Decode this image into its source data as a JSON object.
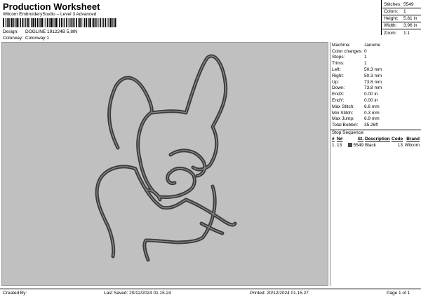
{
  "header": {
    "title": "Production Worksheet",
    "subtitle": "Wilcom EmbroideryStudio – Level 3 Advanced",
    "design_label": "Design:",
    "design_value": "DOGLINE 191224B 5,8IN",
    "colorway_label": "Colorway:",
    "colorway_value": "Colonway 1"
  },
  "stats": [
    {
      "label": "Stitches:",
      "value": "5549"
    },
    {
      "label": "Colors:",
      "value": "1"
    },
    {
      "label": "Height:",
      "value": "5.81 in"
    },
    {
      "label": "Width:",
      "value": "3.96 in"
    },
    {
      "label": "Zoom:",
      "value": "1:1"
    }
  ],
  "machine": [
    {
      "label": "Machine:",
      "value": "Janome"
    },
    {
      "label": "Color changes:",
      "value": "0"
    },
    {
      "label": "Stops:",
      "value": "1"
    },
    {
      "label": "Trims:",
      "value": "1"
    },
    {
      "label": "Left:",
      "value": "50.3 mm"
    },
    {
      "label": "Right:",
      "value": "50.3 mm"
    },
    {
      "label": "Up:",
      "value": "73.8 mm"
    },
    {
      "label": "Down:",
      "value": "73.8 mm"
    },
    {
      "label": "EndX:",
      "value": "0.00 in"
    },
    {
      "label": "EndY:",
      "value": "0.00 in"
    },
    {
      "label": "Max Stitch:",
      "value": "6.6 mm"
    },
    {
      "label": "Min Stitch:",
      "value": "0.3 mm"
    },
    {
      "label": "Max Jump:",
      "value": "6.9 mm"
    },
    {
      "label": "Total Bobbin:",
      "value": "35.26ft"
    }
  ],
  "stop_sequence": {
    "title": "Stop Sequence:",
    "headers": {
      "idx": "#",
      "n": "N#",
      "st": "St.",
      "desc": "Description",
      "code": "Code",
      "mfr": "Brand"
    },
    "rows": [
      {
        "idx": "1.",
        "n": "13",
        "st": "5549",
        "desc": "Black",
        "code": "13",
        "mfr": "Wilcom"
      }
    ],
    "swatch_color": "#4a4a4a"
  },
  "footer": {
    "created": "Created By:",
    "saved": "Last Saved: 20/12/2024 01.15.24",
    "printed": "Printed: 20/12/2024 01.15.27",
    "page": "Page 1 of 1"
  },
  "colors": {
    "canvas_bg": "#c0c0c0",
    "stitch_dark": "#3b3b3b",
    "stitch_light": "#8a8a8a"
  }
}
